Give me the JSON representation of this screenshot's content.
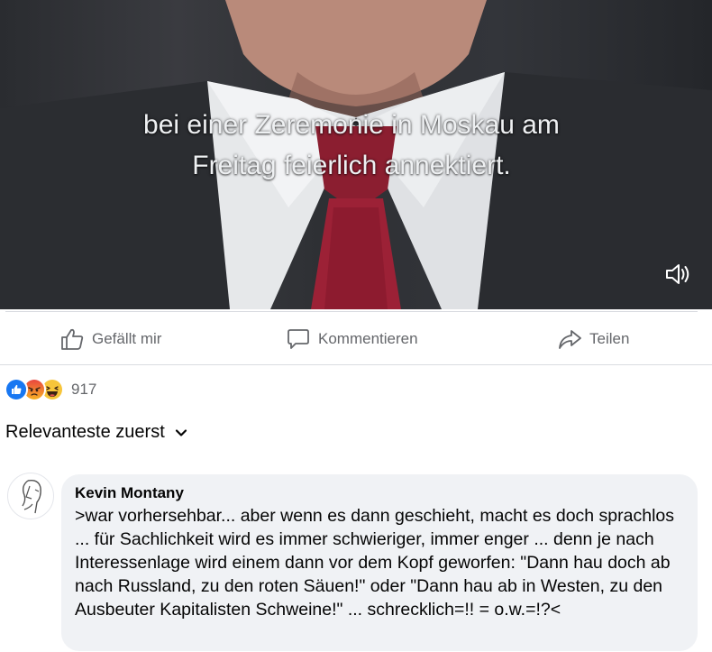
{
  "video": {
    "subtitle_line1": "bei einer Zeremonie in Moskau am",
    "subtitle_line2": "Freitag feierlich annektiert.",
    "volume_icon": "speaker-icon"
  },
  "actions": {
    "like_label": "Gefällt mir",
    "comment_label": "Kommentieren",
    "share_label": "Teilen"
  },
  "reactions": {
    "icons": [
      "like-reaction-icon",
      "angry-reaction-icon",
      "haha-reaction-icon"
    ],
    "count": "917"
  },
  "sort": {
    "label": "Relevanteste zuerst",
    "icon": "chevron-down-icon"
  },
  "comment": {
    "author": "Kevin Montany",
    "text": ">war vorhersehbar... aber wenn es dann geschieht, macht es doch sprachlos ... für Sachlichkeit wird es immer schwieriger, immer enger ... denn je nach Interessenlage wird einem dann vor dem Kopf geworfen: \"Dann hau doch ab nach Russland, zu den roten Säuen!\" oder \"Dann hau ab in Westen, zu den Ausbeuter Kapitalisten Schweine!\" ... schrecklich=!! = o.w.=!?<"
  },
  "colors": {
    "muted_text": "#65676b",
    "bubble_bg": "#f0f2f5",
    "like_blue": "#1877f2"
  }
}
